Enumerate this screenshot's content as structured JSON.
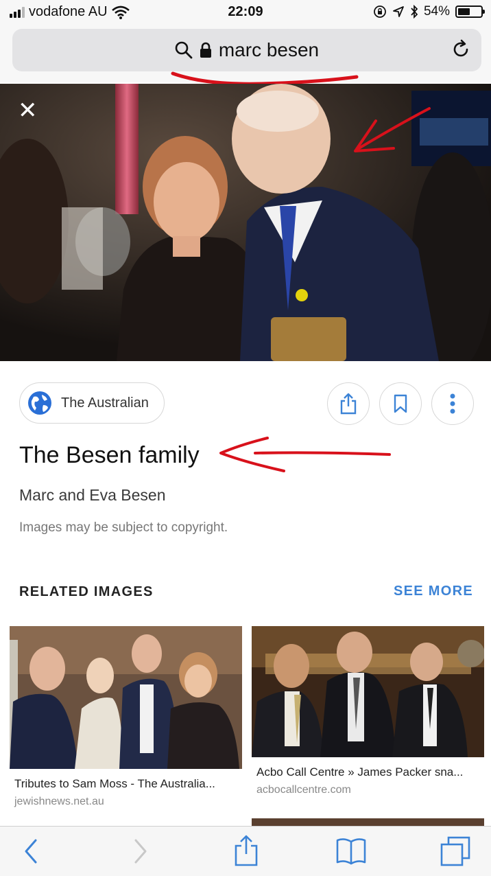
{
  "status": {
    "carrier": "vodafone AU",
    "time": "22:09",
    "battery": "54%",
    "battery_level": 0.54
  },
  "address": {
    "query": "marc besen"
  },
  "result": {
    "source": "The Australian",
    "title": "The Besen family",
    "subtitle": "Marc and Eva Besen",
    "copyright": "Images may be subject to copyright."
  },
  "related": {
    "heading": "RELATED IMAGES",
    "see_more": "SEE MORE",
    "items": [
      {
        "title": "Tributes to Sam Moss - The Australia...",
        "domain": "jewishnews.net.au"
      },
      {
        "title": "Acbo Call Centre » James Packer sna...",
        "domain": "acbocallcentre.com"
      }
    ]
  },
  "icons": [
    "search-icon",
    "lock-icon",
    "reload-icon",
    "close-icon",
    "globe-icon",
    "share-icon",
    "bookmark-icon",
    "more-icon",
    "back-icon",
    "forward-icon",
    "bookmarks-icon",
    "tabs-icon",
    "wifi-icon",
    "location-icon",
    "bluetooth-icon",
    "orientation-lock-icon"
  ],
  "colors": {
    "accent": "#3c83d6",
    "annotation": "#d8111b"
  }
}
